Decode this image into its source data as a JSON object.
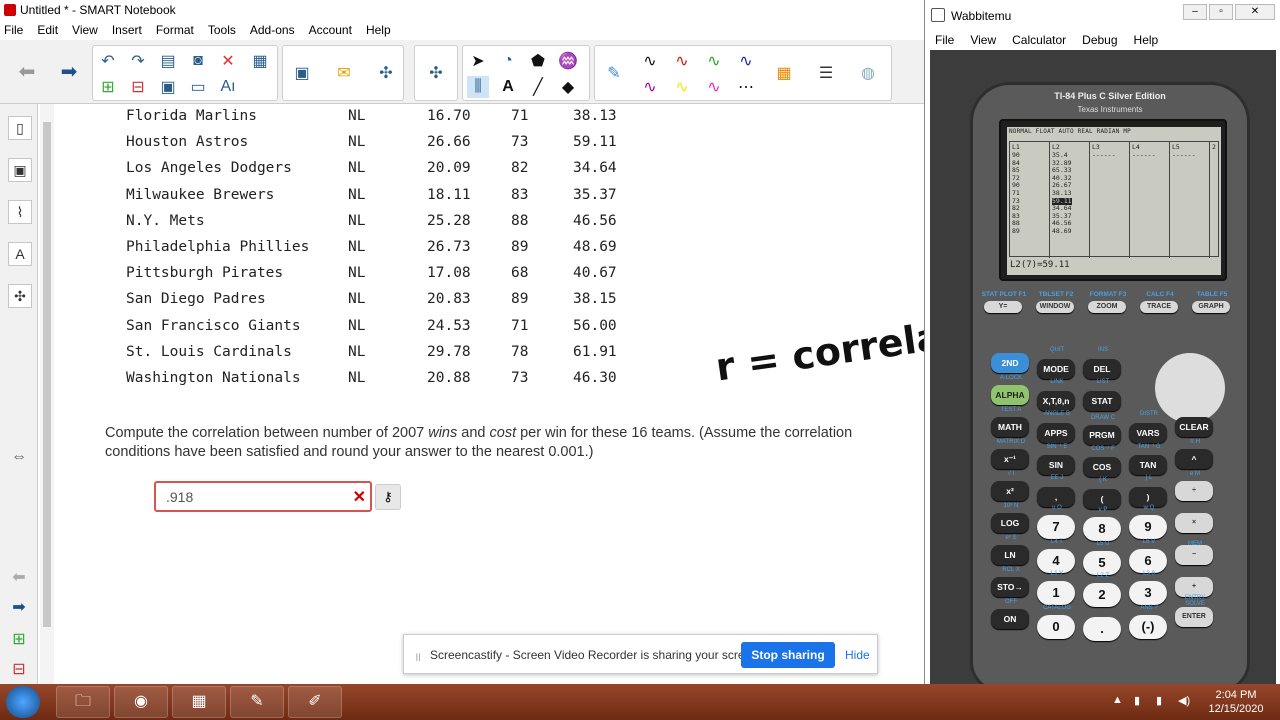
{
  "smart": {
    "title": "Untitled * - SMART Notebook",
    "menu": [
      "File",
      "Edit",
      "View",
      "Insert",
      "Format",
      "Tools",
      "Add-ons",
      "Account",
      "Help"
    ],
    "table": [
      {
        "team": "Florida Marlins",
        "league": "NL",
        "payroll": "16.70",
        "wins": "71",
        "cost": "38.13"
      },
      {
        "team": "Houston Astros",
        "league": "NL",
        "payroll": "26.66",
        "wins": "73",
        "cost": "59.11"
      },
      {
        "team": "Los Angeles Dodgers",
        "league": "NL",
        "payroll": "20.09",
        "wins": "82",
        "cost": "34.64"
      },
      {
        "team": "Milwaukee Brewers",
        "league": "NL",
        "payroll": "18.11",
        "wins": "83",
        "cost": "35.37"
      },
      {
        "team": "N.Y. Mets",
        "league": "NL",
        "payroll": "25.28",
        "wins": "88",
        "cost": "46.56"
      },
      {
        "team": "Philadelphia Phillies",
        "league": "NL",
        "payroll": "26.73",
        "wins": "89",
        "cost": "48.69"
      },
      {
        "team": "Pittsburgh Pirates",
        "league": "NL",
        "payroll": "17.08",
        "wins": "68",
        "cost": "40.67"
      },
      {
        "team": "San Diego Padres",
        "league": "NL",
        "payroll": "20.83",
        "wins": "89",
        "cost": "38.15"
      },
      {
        "team": "San Francisco Giants",
        "league": "NL",
        "payroll": "24.53",
        "wins": "71",
        "cost": "56.00"
      },
      {
        "team": "St. Louis Cardinals",
        "league": "NL",
        "payroll": "29.78",
        "wins": "78",
        "cost": "61.91"
      },
      {
        "team": "Washington Nationals",
        "league": "NL",
        "payroll": "20.88",
        "wins": "73",
        "cost": "46.30"
      }
    ],
    "question_a": "Compute the correlation between number of 2007 ",
    "question_b": "wins",
    "question_c": " and ",
    "question_d": "cost",
    "question_e": " per win for these 16 teams. (Assume the correlation conditions have been satisfied and round your answer to the nearest 0.001.)",
    "answer_value": ".918",
    "answer_clear": "✕",
    "key_icon": "⚷",
    "handwriting": "r = correlat",
    "share_text": "Screencastify - Screen Video Recorder is sharing your screen.",
    "share_stop": "Stop sharing",
    "share_hide": "Hide"
  },
  "wabbit": {
    "title": "Wabbitemu",
    "menu": [
      "File",
      "View",
      "Calculator",
      "Debug",
      "Help"
    ],
    "model": "TI-84 Plus C Silver Edition",
    "maker": "Texas Instruments",
    "lcd_header": "NORMAL FLOAT AUTO REAL RADIAN MP",
    "lcd_cols": [
      "L1",
      "L2",
      "L3",
      "L4",
      "L5"
    ],
    "lcd_col_num": "2",
    "L1": [
      "90",
      "84",
      "85",
      "72",
      "90",
      "71",
      "73",
      "82",
      "83",
      "88",
      "89"
    ],
    "L2": [
      "35.4",
      "32.89",
      "65.33",
      "40.32",
      "26.67",
      "38.13",
      "59.11",
      "34.64",
      "35.37",
      "46.56",
      "48.69"
    ],
    "lcd_dash": "------",
    "lcd_footer": "L2(7)=59.11",
    "fkeys": [
      {
        "top": "STAT PLOT F1",
        "btn": "Y="
      },
      {
        "top": "TBLSET F2",
        "btn": "WINDOW"
      },
      {
        "top": "FORMAT F3",
        "btn": "ZOOM"
      },
      {
        "top": "CALC F4",
        "btn": "TRACE"
      },
      {
        "top": "TABLE F5",
        "btn": "GRAPH"
      }
    ],
    "keys": {
      "k2nd": "2ND",
      "mode": "MODE",
      "del": "DEL",
      "alpha": "ALPHA",
      "xton": "X,T,θ,n",
      "stat": "STAT",
      "math": "MATH",
      "apps": "APPS",
      "prgm": "PRGM",
      "vars": "VARS",
      "clear": "CLEAR",
      "xinv": "x⁻¹",
      "sin": "SIN",
      "cos": "COS",
      "tan": "TAN",
      "pow": "^",
      "x2": "x²",
      "comma": ",",
      "lp": "(",
      "rp": ")",
      "div": "÷",
      "log": "LOG",
      "n7": "7",
      "n8": "8",
      "n9": "9",
      "mul": "×",
      "ln": "LN",
      "n4": "4",
      "n5": "5",
      "n6": "6",
      "sub": "−",
      "sto": "STO→",
      "n1": "1",
      "n2": "2",
      "n3": "3",
      "add": "+",
      "on": "ON",
      "n0": "0",
      "dot": ".",
      "neg": "(-)",
      "enter": "ENTER"
    },
    "labels2": {
      "quit": "QUIT",
      "ins": "INS",
      "alock": "A-LOCK",
      "link": "LINK",
      "list": "LIST",
      "test": "TEST A",
      "angle": "ANGLE B",
      "draw": "DRAW C",
      "distr": "DISTR",
      "matrix": "MATRIX D",
      "sin1": "SIN⁻¹ E",
      "cos1": "COS⁻¹ F",
      "tan1": "TAN⁻¹ G",
      "pi": "π H",
      "sqrt": "√ I",
      "ee": "EE J",
      "lbr": "{ K",
      "rbr": "} L",
      "e": "e M",
      "tenx": "10ˣ N",
      "u": "u O",
      "v": "v P",
      "w": "w Q",
      "mem": "MEM",
      "ex": "eˣ S",
      "l4": "L4 T",
      "l5": "L5 U",
      "l6": "L6 V",
      "rcl": "RCL X",
      "l1": "L1 Y",
      "l2": "L2 Z",
      "l3": "L3 θ",
      "off": "OFF",
      "catalog": "CATALOG",
      "ans": "ANS ?",
      "entry": "ENTRY SOLVE"
    }
  },
  "taskbar": {
    "time": "2:04 PM",
    "date": "12/15/2020"
  }
}
